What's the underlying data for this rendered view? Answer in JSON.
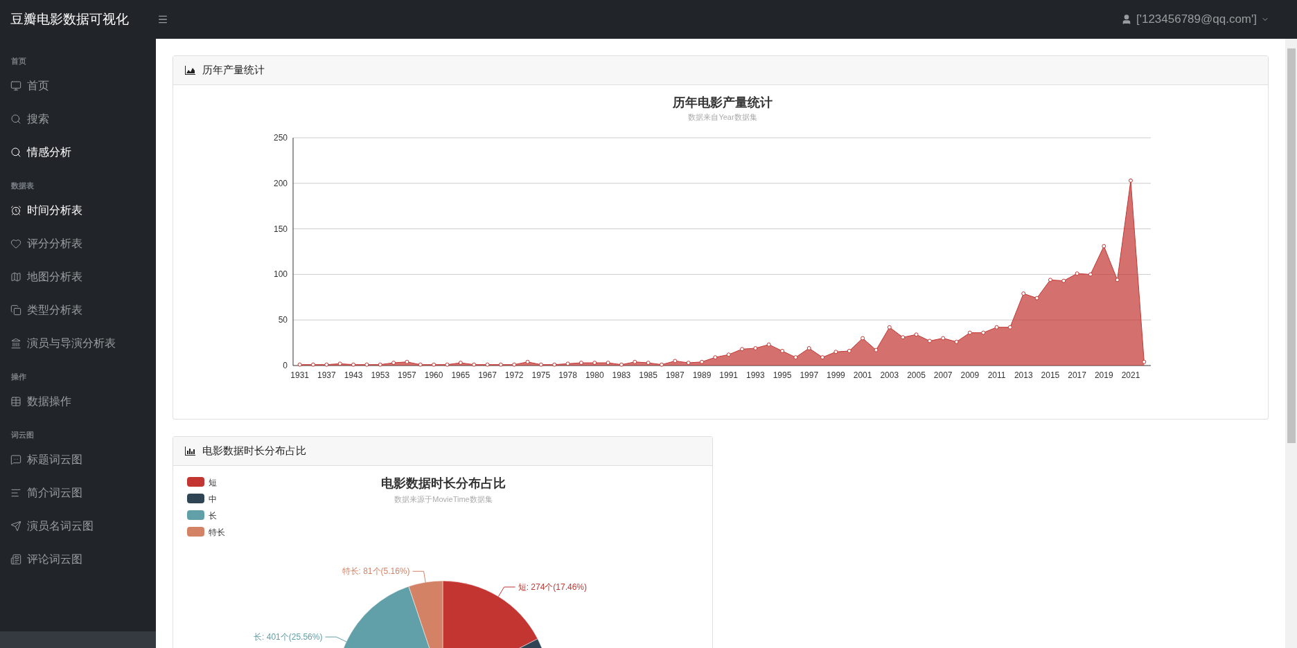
{
  "topbar": {
    "brand": "豆瓣电影数据可视化",
    "user": "['123456789@qq.com']"
  },
  "sidebar": {
    "sections": [
      {
        "heading": "首页",
        "items": [
          {
            "label": "首页",
            "selected": false
          },
          {
            "label": "搜索",
            "selected": false
          },
          {
            "label": "情感分析",
            "selected": true
          }
        ]
      },
      {
        "heading": "数据表",
        "items": [
          {
            "label": "时间分析表",
            "selected": true
          },
          {
            "label": "评分分析表",
            "selected": false
          },
          {
            "label": "地图分析表",
            "selected": false
          },
          {
            "label": "类型分析表",
            "selected": false
          },
          {
            "label": "演员与导演分析表",
            "selected": false
          }
        ]
      },
      {
        "heading": "操作",
        "items": [
          {
            "label": "数据操作",
            "selected": false
          }
        ]
      },
      {
        "heading": "词云图",
        "items": [
          {
            "label": "标题词云图",
            "selected": false
          },
          {
            "label": "简介词云图",
            "selected": false
          },
          {
            "label": "演员名词云图",
            "selected": false
          },
          {
            "label": "评论词云图",
            "selected": false
          }
        ]
      }
    ]
  },
  "cards": [
    {
      "header": "历年产量统计",
      "chart_data": {
        "type": "area",
        "title": "历年电影产量统计",
        "subtitle": "数据来自Year数据集",
        "categories": [
          "1931",
          null,
          "1937",
          null,
          "1943",
          null,
          "1953",
          null,
          "1957",
          null,
          "1960",
          null,
          "1965",
          null,
          "1967",
          null,
          "1972",
          null,
          "1975",
          null,
          "1978",
          null,
          "1980",
          null,
          "1983",
          null,
          "1985",
          null,
          "1987",
          null,
          "1989",
          null,
          "1991",
          null,
          "1993",
          null,
          "1995",
          null,
          "1997",
          null,
          "1999",
          null,
          "2001",
          null,
          "2003",
          null,
          "2005",
          null,
          "2007",
          null,
          "2009",
          null,
          "2011",
          null,
          "2013",
          null,
          "2015",
          null,
          "2017",
          null,
          "2019",
          null,
          "2021",
          null
        ],
        "series": [
          {
            "color": "#c23531",
            "values": [
              1,
              1,
              1,
              2,
              1,
              1,
              1,
              3,
              4,
              1,
              1,
              1,
              3,
              1,
              1,
              1,
              1,
              4,
              1,
              1,
              2,
              3,
              3,
              3,
              1,
              4,
              3,
              1,
              5,
              3,
              4,
              9,
              12,
              18,
              19,
              23,
              16,
              9,
              19,
              9,
              15,
              16,
              30,
              17,
              42,
              31,
              34,
              27,
              30,
              26,
              36,
              36,
              42,
              42,
              79,
              74,
              94,
              93,
              101,
              100,
              131,
              94,
              203,
              4
            ]
          }
        ],
        "grid": true,
        "ylim": [
          0,
          250
        ],
        "yticks": [
          0,
          50,
          100,
          150,
          200,
          250
        ]
      }
    },
    {
      "header": "电影数据时长分布占比",
      "chart_data": {
        "type": "pie",
        "title": "电影数据时长分布占比",
        "subtitle": "数据来源于MovieTime数据集",
        "categories": [
          "短",
          "中",
          "长",
          "特长"
        ],
        "values": [
          274,
          813,
          401,
          81
        ],
        "colors": [
          "#c23531",
          "#2f4554",
          "#61a0a8",
          "#d48265"
        ],
        "legend": true,
        "value_labels": [
          "短: 274个(17.46%)",
          null,
          "长: 401个(25.56%)",
          "特长: 81个(5.16%)"
        ]
      }
    }
  ]
}
